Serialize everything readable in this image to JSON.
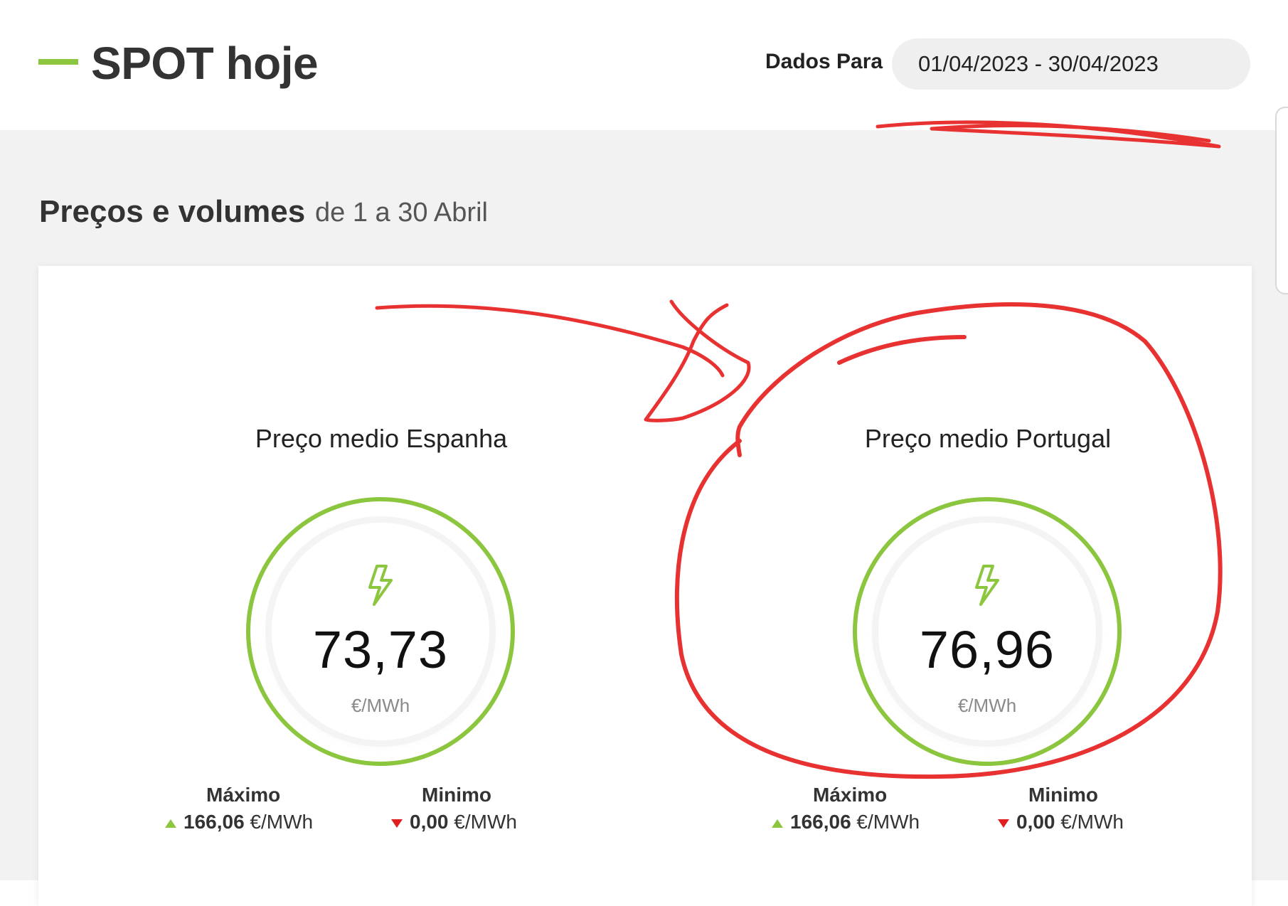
{
  "header": {
    "title": "SPOT hoje",
    "data_label": "Dados Para",
    "date_range": "01/04/2023 - 30/04/2023"
  },
  "section": {
    "title": "Preços e volumes",
    "subtitle": "de 1 a 30 Abril"
  },
  "metrics": [
    {
      "title": "Preço medio Espanha",
      "value": "73,73",
      "unit": "€/MWh",
      "max_label": "Máximo",
      "max_value": "166,06",
      "max_unit": "€/MWh",
      "min_label": "Minimo",
      "min_value": "0,00",
      "min_unit": "€/MWh"
    },
    {
      "title": "Preço medio Portugal",
      "value": "76,96",
      "unit": "€/MWh",
      "max_label": "Máximo",
      "max_value": "166,06",
      "max_unit": "€/MWh",
      "min_label": "Minimo",
      "min_value": "0,00",
      "min_unit": "€/MWh"
    }
  ],
  "icons": {
    "bolt": "lightning-bolt-icon",
    "max_indicator": "arrow-up-icon",
    "min_indicator": "arrow-down-icon"
  },
  "colors": {
    "accent_green": "#8cc63f",
    "down_red": "#e02020",
    "annotation_red": "#e83232",
    "background_gray": "#f2f2f2"
  }
}
